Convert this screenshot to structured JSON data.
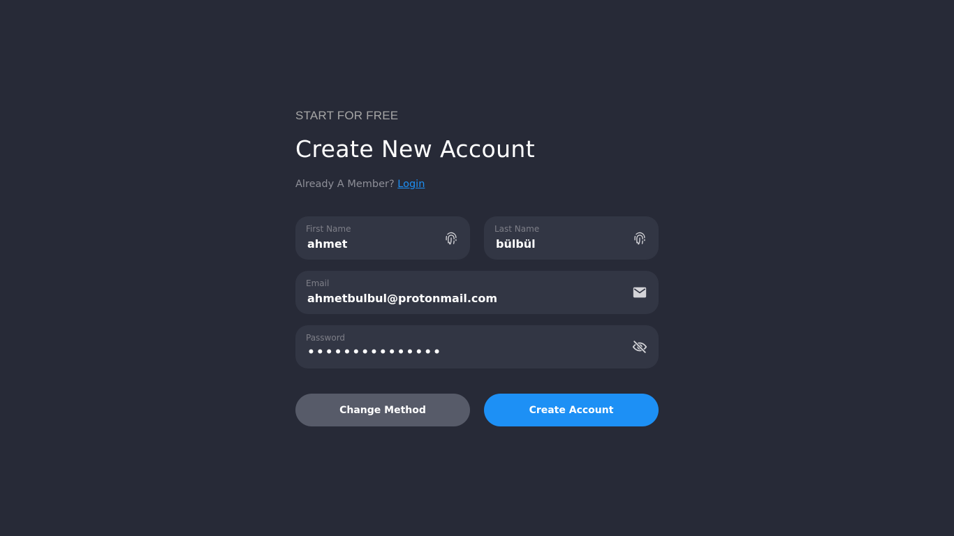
{
  "header": {
    "eyebrow": "START FOR FREE",
    "title": "Create New Account",
    "member_text": "Already A Member?",
    "login_link": "Login"
  },
  "form": {
    "first_name": {
      "label": "First Name",
      "value": "ahmet",
      "icon": "fingerprint-icon"
    },
    "last_name": {
      "label": "Last Name",
      "value": "bülbül",
      "icon": "fingerprint-icon"
    },
    "email": {
      "label": "Email",
      "value": "ahmetbulbul@protonmail.com",
      "icon": "envelope-icon"
    },
    "password": {
      "label": "Password",
      "value": "•••••••••••••••",
      "icon": "eye-slash-icon"
    }
  },
  "actions": {
    "change_method": "Change Method",
    "create_account": "Create Account"
  },
  "colors": {
    "background": "#272a37",
    "field_background": "#323644",
    "accent": "#1d90f5",
    "secondary_button": "#575b69"
  }
}
